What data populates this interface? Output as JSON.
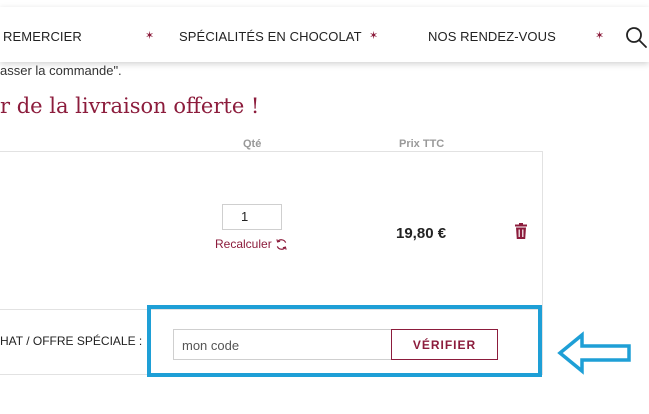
{
  "nav": {
    "items": [
      "REMERCIER",
      "SPÉCIALITÉS EN CHOCOLAT",
      "NOS RENDEZ-VOUS"
    ],
    "separator": "✶",
    "search_icon": "search-icon"
  },
  "page": {
    "breadcrumb_fragment": "asser la commande\".",
    "headline": "r de la livraison offerte !"
  },
  "cart": {
    "columns": {
      "qty": "Qté",
      "price": "Prix TTC"
    },
    "item": {
      "quantity": "1",
      "recalc_label": "Recalculer",
      "price": "19,80 €"
    }
  },
  "promo": {
    "label": "HAT / OFFRE SPÉCIALE :",
    "placeholder": "mon code",
    "verify_label": "VÉRIFIER"
  },
  "colors": {
    "brand": "#8c1c3c",
    "highlight": "#1e9fd6"
  }
}
